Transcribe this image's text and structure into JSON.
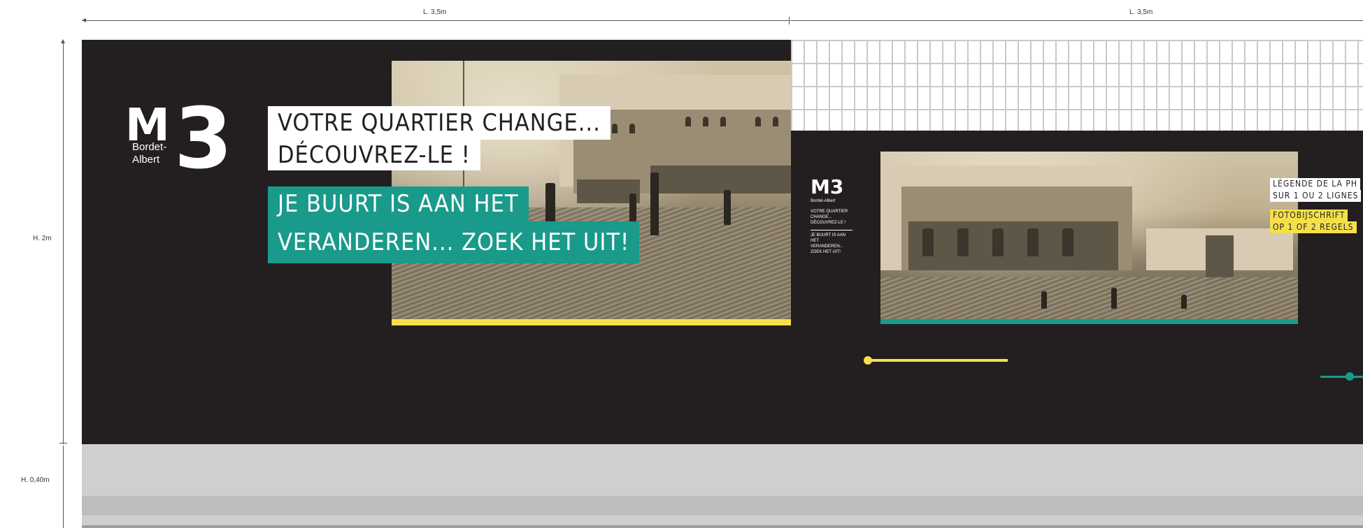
{
  "dimensions": {
    "width_left": "L. 3,5m",
    "width_right": "L. 3,5m",
    "height_main": "H. 2m",
    "height_base": "H. 0,40m"
  },
  "logo": {
    "mark": "M",
    "number": "3",
    "line1": "Bordet-",
    "line2": "Albert"
  },
  "panel1": {
    "fr_line1": "VOTRE QUARTIER CHANGE...",
    "fr_line2": "DÉCOUVREZ-LE !",
    "nl_line1": "JE BUURT IS AAN HET",
    "nl_line2": "VERANDEREN... ZOEK HET UIT!"
  },
  "panel2": {
    "small_logo_mark": "M3",
    "small_logo_text": "Bordet-Albert",
    "small_fr": "VOTRE QUARTIER CHANGE... DÉCOUVREZ-LE !",
    "small_nl": "JE BUURT IS AAN HET VERANDEREN... ZOEK HET UIT!",
    "caption_fr_1": "LÉGENDE DE LA PH",
    "caption_fr_2": "SUR 1 OU 2 LIGNES",
    "caption_nl_1": "FOTOBIJSCHRIFT",
    "caption_nl_2": "OP 1 OF 2 REGELS"
  },
  "colors": {
    "dark": "#231f20",
    "teal": "#1a9a8a",
    "yellow": "#f5e04a",
    "base_light": "#cfcfcd",
    "base_dark": "#bdbdbb"
  }
}
